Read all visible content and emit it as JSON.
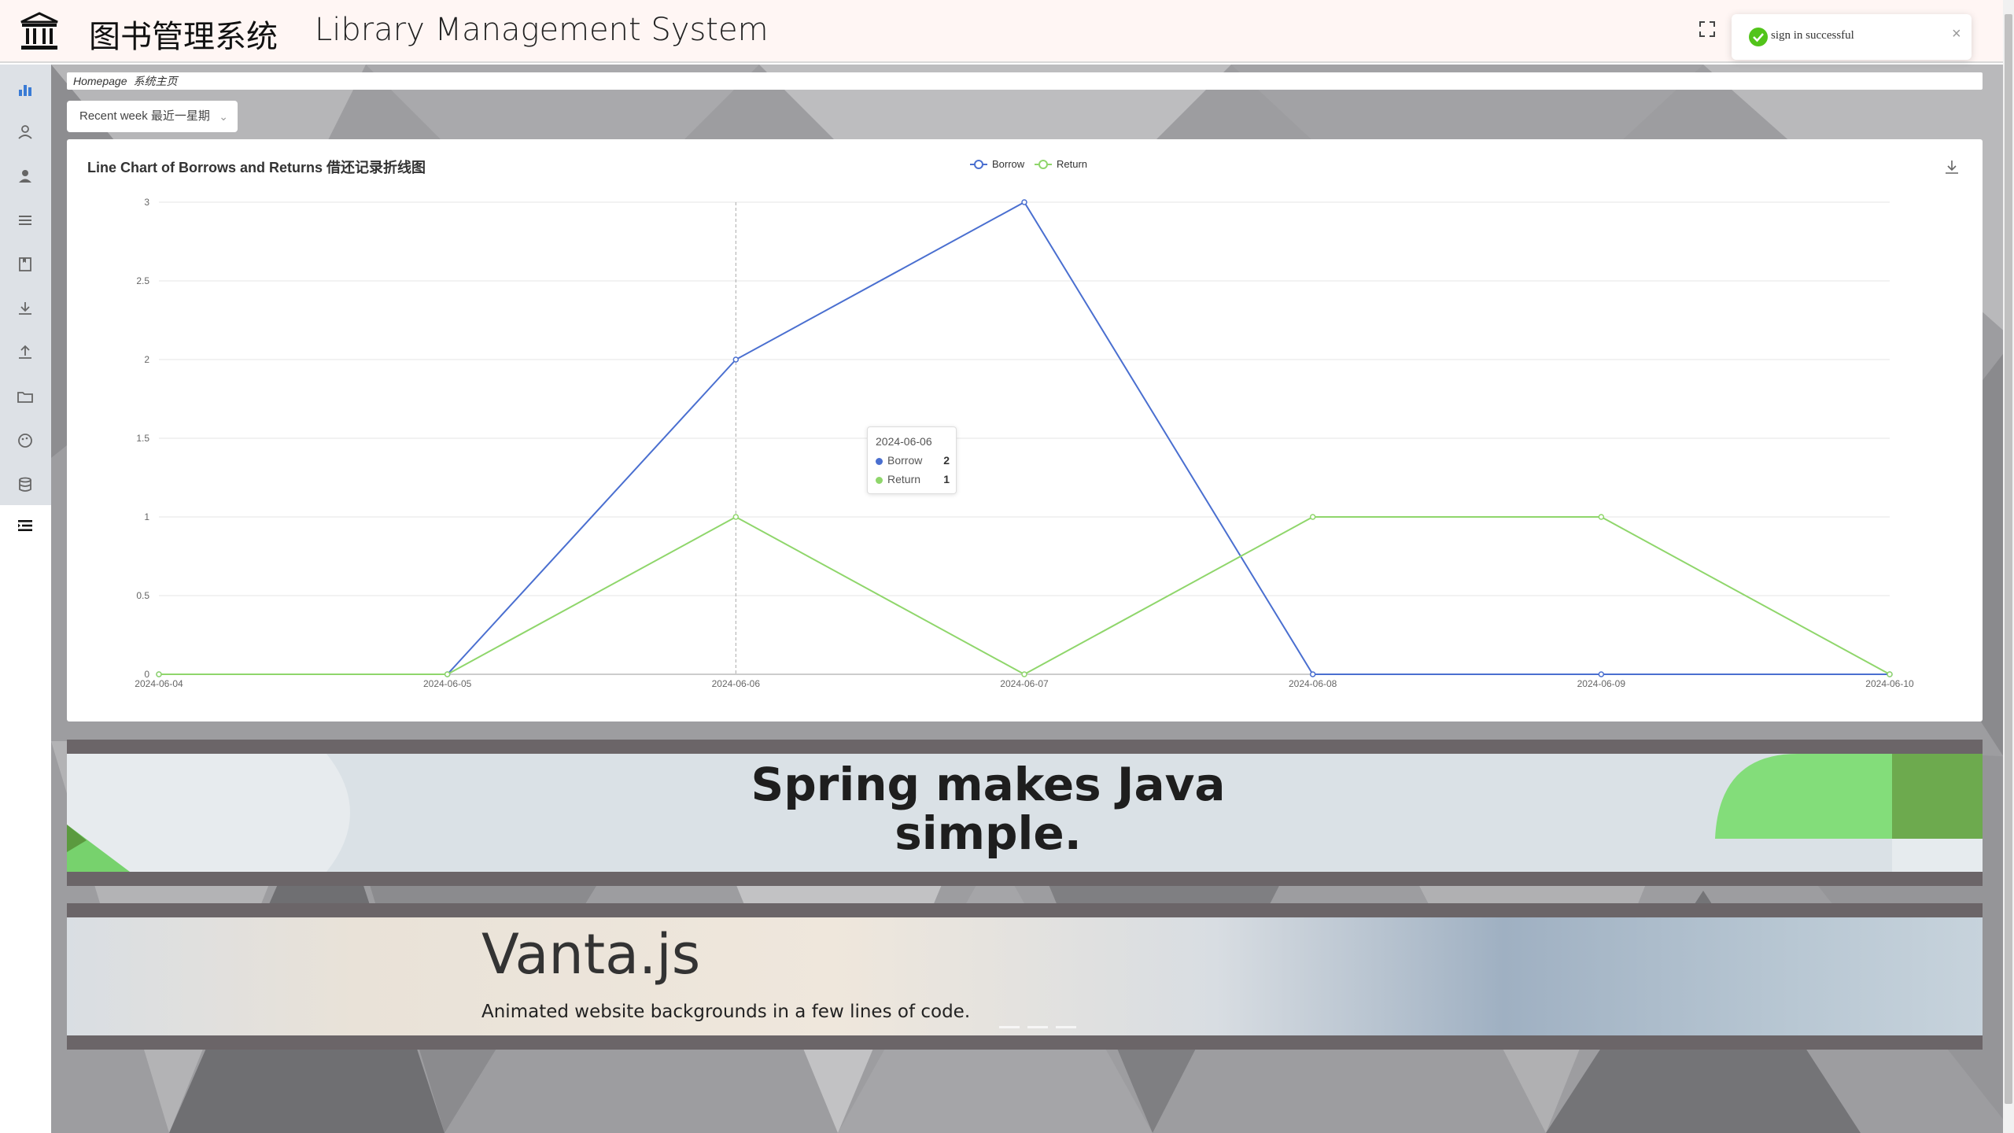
{
  "header": {
    "title_cn": "图书管理系统",
    "title_en": "Library Management System"
  },
  "toast": {
    "message": "sign in successful",
    "close": "×"
  },
  "breadcrumb": {
    "home": "Homepage",
    "current": "系统主页"
  },
  "range_select": {
    "value": "Recent week 最近一星期"
  },
  "chart_data": {
    "type": "line",
    "title": "Line Chart of Borrows and Returns 借还记录折线图",
    "x": [
      "2024-06-04",
      "2024-06-05",
      "2024-06-06",
      "2024-06-07",
      "2024-06-08",
      "2024-06-09",
      "2024-06-10"
    ],
    "series": [
      {
        "name": "Borrow",
        "values": [
          0,
          0,
          2,
          3,
          0,
          0,
          0
        ],
        "color": "#4a6fd0"
      },
      {
        "name": "Return",
        "values": [
          0,
          0,
          1,
          0,
          1,
          1,
          0
        ],
        "color": "#8fd66b"
      }
    ],
    "ylim": [
      0,
      3
    ],
    "yticks": [
      "0",
      "0.5",
      "1",
      "1.5",
      "2",
      "2.5",
      "3"
    ],
    "legend": "top-center",
    "grid": true
  },
  "tooltip": {
    "date": "2024-06-06",
    "rows": [
      {
        "label": "Borrow",
        "value": "2",
        "color": "#4a6fd0"
      },
      {
        "label": "Return",
        "value": "1",
        "color": "#8fd66b"
      }
    ]
  },
  "banners": {
    "spring_line1": "Spring makes Java",
    "spring_line2": "simple.",
    "vanta_title": "Vanta.js",
    "vanta_subtitle": "Animated website backgrounds in a few lines of code."
  },
  "sidebar": {
    "icons": [
      "chart-icon",
      "user-icon",
      "user-filled-icon",
      "list-icon",
      "book-icon",
      "download-icon",
      "upload-icon",
      "folder-icon",
      "palette-icon",
      "database-icon",
      "menu-toggle-icon"
    ]
  },
  "colors": {
    "header_bg": "#fff6f4",
    "sidebar_bg": "#dde1e6",
    "borrow": "#4a6fd0",
    "return": "#8fd66b",
    "success": "#52c41a"
  }
}
